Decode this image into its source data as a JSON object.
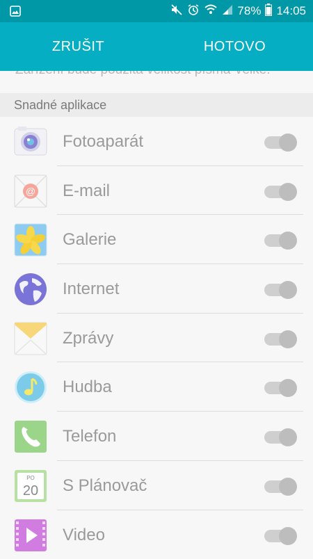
{
  "status_bar": {
    "battery": "78%",
    "time": "14:05"
  },
  "action_bar": {
    "cancel_label": "ZRUŠIT",
    "done_label": "HOTOVO"
  },
  "top_snippet": "Zařízení bude použita velikost písma Velké.",
  "section": {
    "title": "Snadné aplikace"
  },
  "apps": [
    {
      "label": "Fotoaparát",
      "icon": "camera-icon",
      "enabled": true
    },
    {
      "label": "E-mail",
      "icon": "email-icon",
      "enabled": true
    },
    {
      "label": "Galerie",
      "icon": "gallery-icon",
      "enabled": true
    },
    {
      "label": "Internet",
      "icon": "internet-icon",
      "enabled": true
    },
    {
      "label": "Zprávy",
      "icon": "messages-icon",
      "enabled": true
    },
    {
      "label": "Hudba",
      "icon": "music-icon",
      "enabled": true
    },
    {
      "label": "Telefon",
      "icon": "phone-icon",
      "enabled": true
    },
    {
      "label": "S Plánovač",
      "icon": "calendar-icon",
      "enabled": true,
      "icon_text_top": "PO",
      "icon_text_num": "20"
    },
    {
      "label": "Video",
      "icon": "video-icon",
      "enabled": true
    }
  ],
  "colors": {
    "status_bar": "#0097a7",
    "action_bar": "#06aec3"
  }
}
